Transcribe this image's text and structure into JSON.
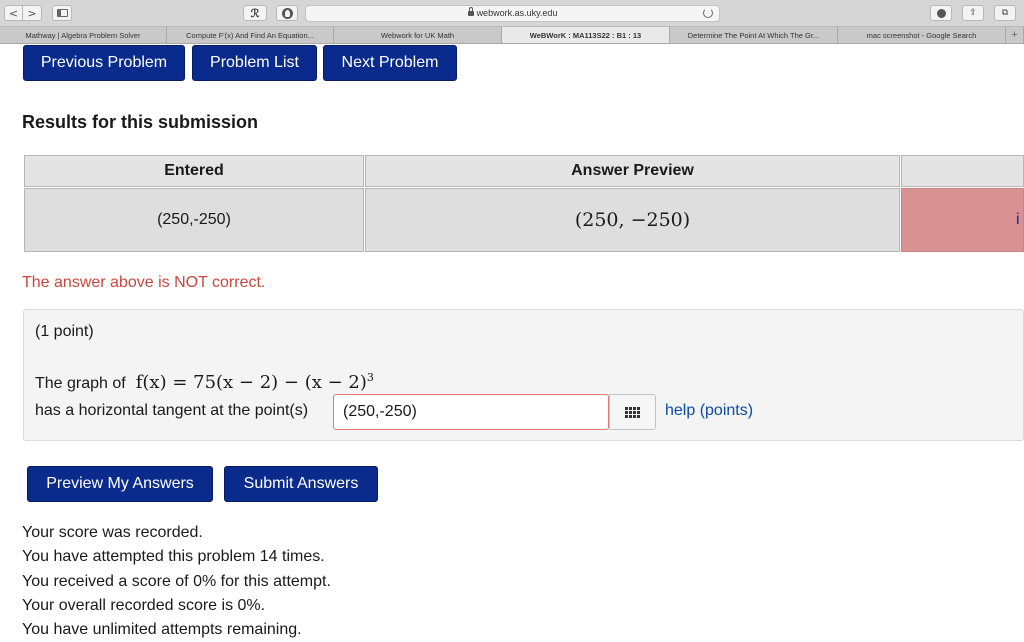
{
  "browser": {
    "url": "webwork.as.uky.edu",
    "tabs": [
      {
        "label": "Mathway | Algebra Problem Solver",
        "active": false
      },
      {
        "label": "Compute F'(x) And Find An Equation...",
        "active": false
      },
      {
        "label": "Webwork for UK Math",
        "active": false
      },
      {
        "label": "WeBWorK : MA113S22 : B1 : 13",
        "active": true
      },
      {
        "label": "Determine The Point At Which The Gr...",
        "active": false
      },
      {
        "label": "mac screenshot - Google Search",
        "active": false
      }
    ],
    "icons": {
      "back": "chevron-left-icon",
      "forward": "chevron-right-icon",
      "sidebar": "sidebar-icon",
      "extension_1": "grammarly-extension-icon",
      "extension_2": "ghostery-extension-icon",
      "lock": "lock-icon",
      "reload": "reload-icon",
      "download": "download-icon",
      "share": "share-icon",
      "tabs": "tab-overview-icon",
      "new_tab": "plus-icon"
    },
    "glyphs": {
      "back": "<",
      "forward": ">",
      "share": "⇧",
      "tabs": "⧉",
      "new_tab": "+"
    }
  },
  "nav": {
    "previous": "Previous Problem",
    "list": "Problem List",
    "next": "Next Problem"
  },
  "results": {
    "heading": "Results for this submission",
    "headers": {
      "entered": "Entered",
      "preview": "Answer Preview"
    },
    "entered": "(250,-250)",
    "preview": "(250, −250)",
    "result_fragment": "i"
  },
  "feedback": "The answer above is NOT correct.",
  "problem": {
    "points": "(1 point)",
    "prefix": "The graph of",
    "formula": "f(x) = 75(x − 2) − (x − 2)",
    "exponent": "3",
    "tangent_text": "has a horizontal tangent at the point(s)",
    "answer_value": "(250,-250)",
    "palette_icon": "equation-palette-grid-icon",
    "help_link": "help (points)"
  },
  "actions": {
    "preview": "Preview My Answers",
    "submit": "Submit Answers"
  },
  "status": [
    "Your score was recorded.",
    "You have attempted this problem 14 times.",
    "You received a score of 0% for this attempt.",
    "Your overall recorded score is 0%.",
    "You have unlimited attempts remaining."
  ],
  "colors": {
    "button_blue": "#0a2b8c",
    "incorrect_red": "#c9473f",
    "result_incorrect_bg": "#d99293",
    "link_blue": "#0b4aa6"
  }
}
